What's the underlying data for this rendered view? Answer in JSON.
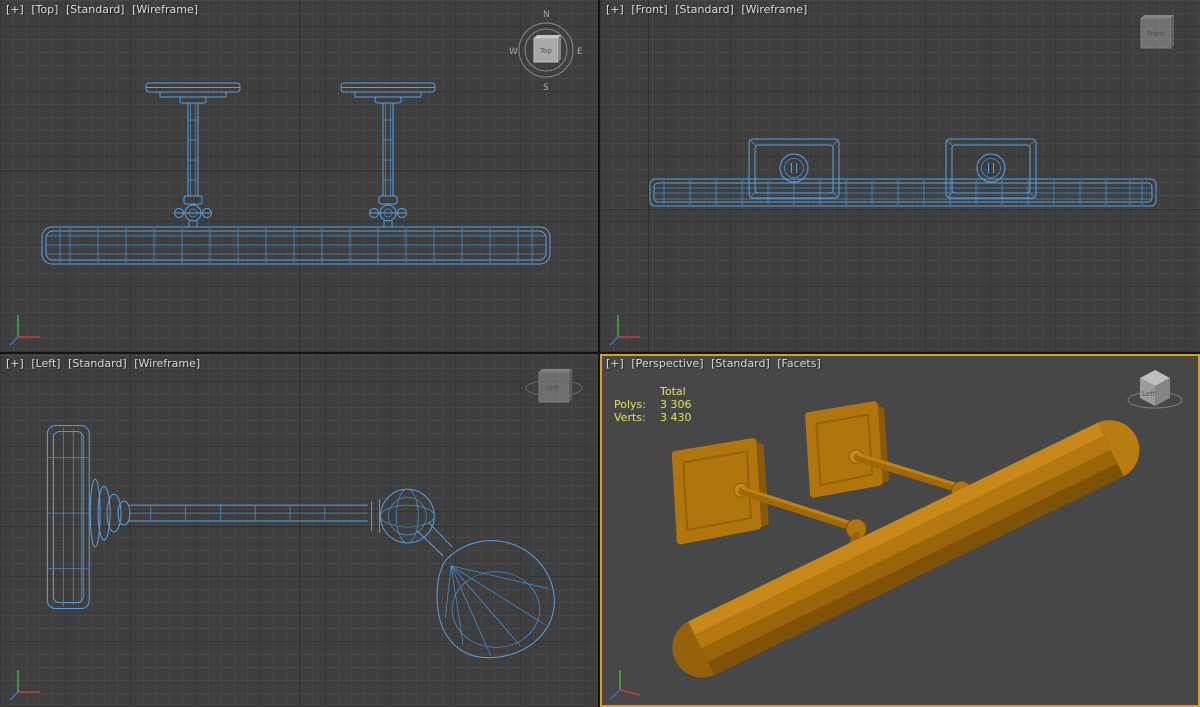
{
  "app": {
    "title": "3ds Max quad viewport"
  },
  "colors": {
    "wireframe_blue": "#5aa2e6",
    "object_orange_base": "#b1750e",
    "object_orange_light": "#c8881a",
    "object_orange_dark": "#7f5208",
    "active_viewport_border": "#d9a21b",
    "statistics_text": "#e6e34e",
    "viewport_background": "#3e3e3e",
    "axis_x": "#cc3b3b",
    "axis_y": "#3fb53f",
    "axis_z": "#4466dd"
  },
  "viewports": {
    "top": {
      "menu": {
        "plus": "[+]",
        "view": "[Top]",
        "style": "[Standard]",
        "shading": "[Wireframe]"
      },
      "viewcube": {
        "face_label": "Top",
        "n": "N",
        "s": "S",
        "e": "E",
        "w": "W"
      }
    },
    "front": {
      "menu": {
        "plus": "[+]",
        "view": "[Front]",
        "style": "[Standard]",
        "shading": "[Wireframe]"
      },
      "viewcube": {
        "face_label": "Front"
      }
    },
    "left": {
      "menu": {
        "plus": "[+]",
        "view": "[Left]",
        "style": "[Standard]",
        "shading": "[Wireframe]"
      },
      "viewcube": {
        "face_label": "Left"
      }
    },
    "perspective": {
      "menu": {
        "plus": "[+]",
        "view": "[Perspective]",
        "style": "[Standard]",
        "shading": "[Facets]"
      },
      "viewcube": {
        "face_label": "Left"
      },
      "stats": {
        "total_label": "Total",
        "polys_label": "Polys:",
        "polys_value": "3 306",
        "verts_label": "Verts:",
        "verts_value": "3 430"
      }
    }
  }
}
